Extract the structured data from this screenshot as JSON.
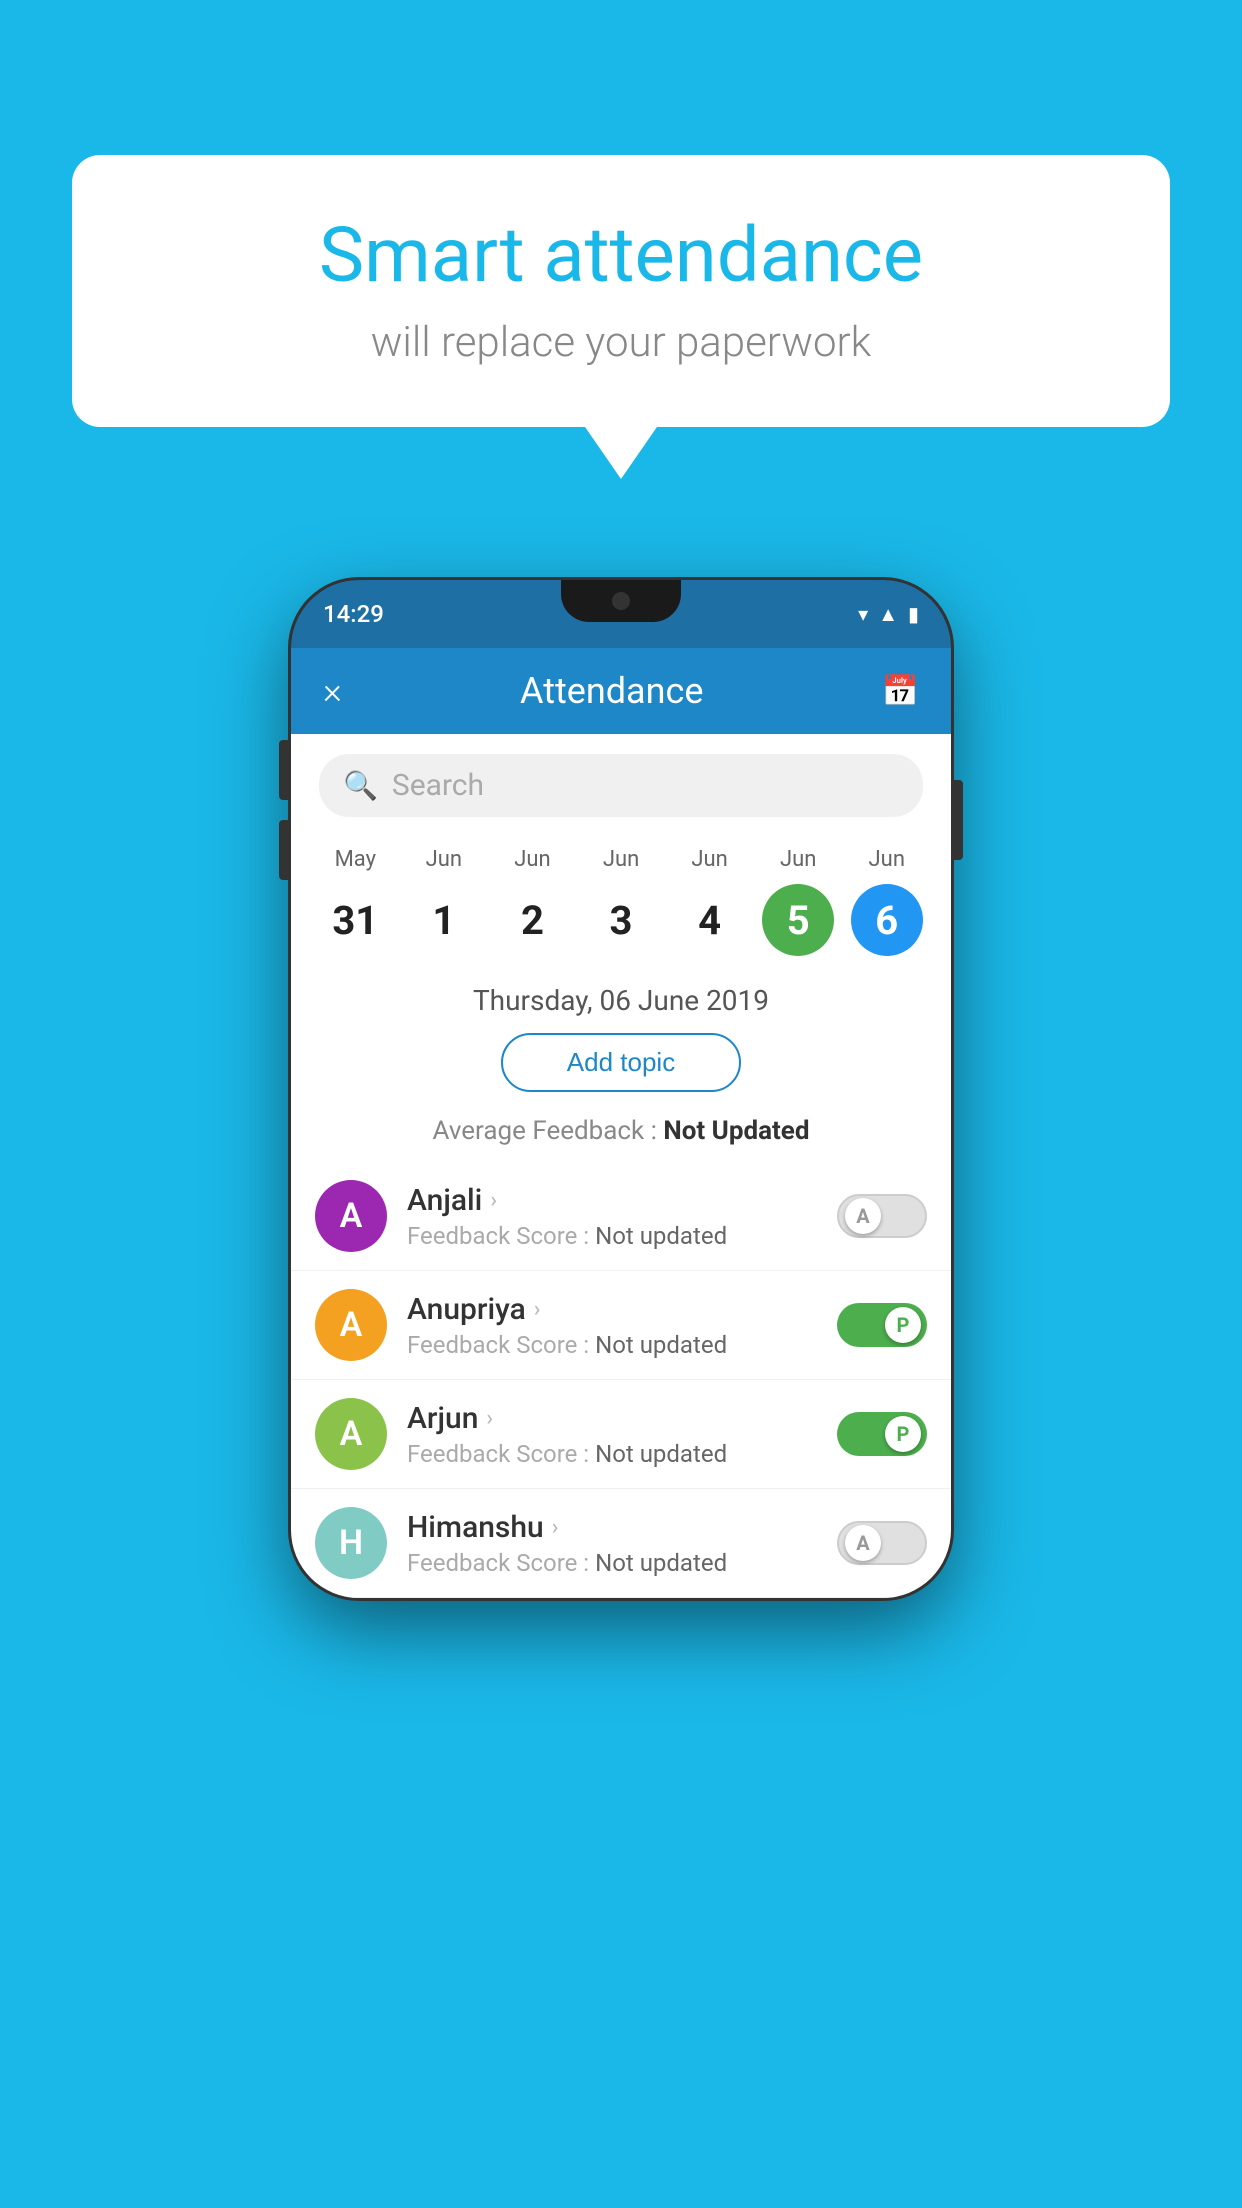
{
  "background_color": "#1ab8e8",
  "bubble": {
    "title": "Smart attendance",
    "subtitle": "will replace your paperwork"
  },
  "status_bar": {
    "time": "14:29",
    "icons": [
      "wifi",
      "signal",
      "battery"
    ]
  },
  "header": {
    "close_label": "×",
    "title": "Attendance",
    "calendar_icon": "📅"
  },
  "search": {
    "placeholder": "Search"
  },
  "calendar": {
    "months": [
      "May",
      "Jun",
      "Jun",
      "Jun",
      "Jun",
      "Jun",
      "Jun"
    ],
    "dates": [
      "31",
      "1",
      "2",
      "3",
      "4",
      "5",
      "6"
    ],
    "selected_index": 6,
    "today_index": 5
  },
  "selected_date_label": "Thursday, 06 June 2019",
  "add_topic_button": "Add topic",
  "avg_feedback": {
    "label": "Average Feedback : ",
    "value": "Not Updated"
  },
  "students": [
    {
      "name": "Anjali",
      "feedback_label": "Feedback Score : ",
      "feedback_value": "Not updated",
      "avatar_letter": "A",
      "avatar_color": "purple",
      "toggle_state": "off",
      "toggle_label": "A"
    },
    {
      "name": "Anupriya",
      "feedback_label": "Feedback Score : ",
      "feedback_value": "Not updated",
      "avatar_letter": "A",
      "avatar_color": "yellow",
      "toggle_state": "on",
      "toggle_label": "P"
    },
    {
      "name": "Arjun",
      "feedback_label": "Feedback Score : ",
      "feedback_value": "Not updated",
      "avatar_letter": "A",
      "avatar_color": "light-green",
      "toggle_state": "on",
      "toggle_label": "P"
    },
    {
      "name": "Himanshu",
      "feedback_label": "Feedback Score : ",
      "feedback_value": "Not updated",
      "avatar_letter": "H",
      "avatar_color": "teal",
      "toggle_state": "off",
      "toggle_label": "A"
    }
  ]
}
